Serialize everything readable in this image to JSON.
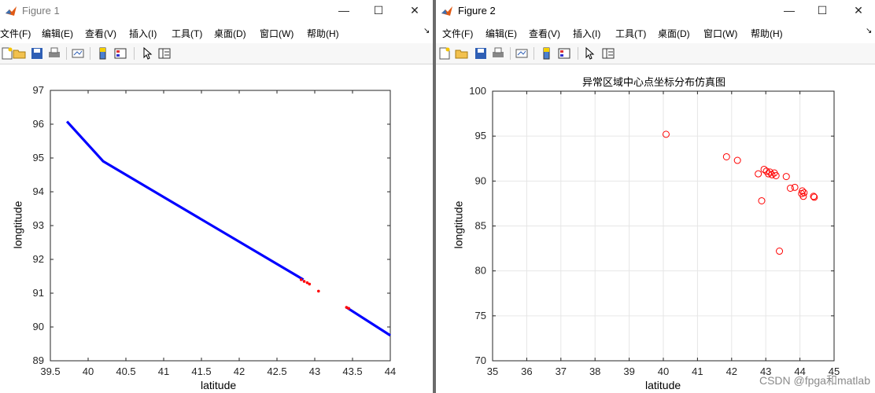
{
  "colors": {
    "line": "#0000ff",
    "marker": "#ff0000",
    "axis": "#000000",
    "grid": "#e6e6e6"
  },
  "windows": [
    {
      "title": "Figure 1",
      "menus": [
        "文件(F)",
        "编辑(E)",
        "查看(V)",
        "插入(I)",
        "工具(T)",
        "桌面(D)",
        "窗口(W)",
        "帮助(H)"
      ],
      "toolbar_icons": [
        "new-figure-icon",
        "open-file-icon",
        "save-icon",
        "print-icon",
        "link-plot-icon",
        "insert-colorbar-icon",
        "insert-legend-icon",
        "edit-plot-icon",
        "property-inspector-icon"
      ]
    },
    {
      "title": "Figure 2",
      "menus": [
        "文件(F)",
        "编辑(E)",
        "查看(V)",
        "插入(I)",
        "工具(T)",
        "桌面(D)",
        "窗口(W)",
        "帮助(H)"
      ],
      "toolbar_icons": [
        "new-figure-icon",
        "open-file-icon",
        "save-icon",
        "print-icon",
        "link-plot-icon",
        "insert-colorbar-icon",
        "insert-legend-icon",
        "edit-plot-icon",
        "property-inspector-icon"
      ]
    }
  ],
  "chart_data": [
    {
      "type": "line",
      "title": "",
      "xlabel": "latitude",
      "ylabel": "longtitude",
      "xlim": [
        39.5,
        44
      ],
      "ylim": [
        89,
        97
      ],
      "xticks": [
        "39.5",
        "40",
        "40.5",
        "41",
        "41.5",
        "42",
        "42.5",
        "43",
        "43.5",
        "44"
      ],
      "yticks": [
        "89",
        "90",
        "91",
        "92",
        "93",
        "94",
        "95",
        "96",
        "97"
      ],
      "grid": false,
      "series": [
        {
          "style": "line",
          "color": "#0000ff",
          "x": [
            39.72,
            40.2,
            42.85
          ],
          "y": [
            96.08,
            94.9,
            91.4
          ]
        },
        {
          "style": "line",
          "color": "#0000ff",
          "x": [
            43.42,
            44.0
          ],
          "y": [
            90.58,
            89.75
          ]
        },
        {
          "style": "dots",
          "color": "#ff0000",
          "x": [
            42.82,
            42.86,
            42.9,
            42.93,
            43.05,
            43.42,
            43.45
          ],
          "y": [
            91.4,
            91.35,
            91.31,
            91.27,
            91.06,
            90.58,
            90.55
          ]
        }
      ]
    },
    {
      "type": "scatter",
      "title": "异常区域中心点坐标分布仿真图",
      "xlabel": "latitude",
      "ylabel": "longtitude",
      "xlim": [
        35,
        45
      ],
      "ylim": [
        70,
        100
      ],
      "xticks": [
        "35",
        "36",
        "37",
        "38",
        "39",
        "40",
        "41",
        "42",
        "43",
        "44",
        "45"
      ],
      "yticks": [
        "70",
        "75",
        "80",
        "85",
        "90",
        "95",
        "100"
      ],
      "grid": true,
      "series": [
        {
          "style": "circles",
          "color": "#ff0000",
          "x": [
            40.08,
            41.85,
            42.17,
            42.78,
            42.88,
            42.95,
            43.02,
            43.08,
            43.12,
            43.18,
            43.25,
            43.3,
            43.4,
            43.6,
            43.72,
            43.85,
            44.05,
            44.07,
            44.1,
            44.12,
            44.4,
            44.42
          ],
          "y": [
            95.2,
            92.7,
            92.3,
            90.8,
            87.8,
            91.3,
            91.1,
            90.8,
            91.0,
            90.7,
            90.9,
            90.6,
            82.2,
            90.5,
            89.2,
            89.3,
            88.6,
            88.9,
            88.3,
            88.7,
            88.3,
            88.2
          ]
        }
      ]
    }
  ],
  "watermark": "CSDN @fpga和matlab"
}
